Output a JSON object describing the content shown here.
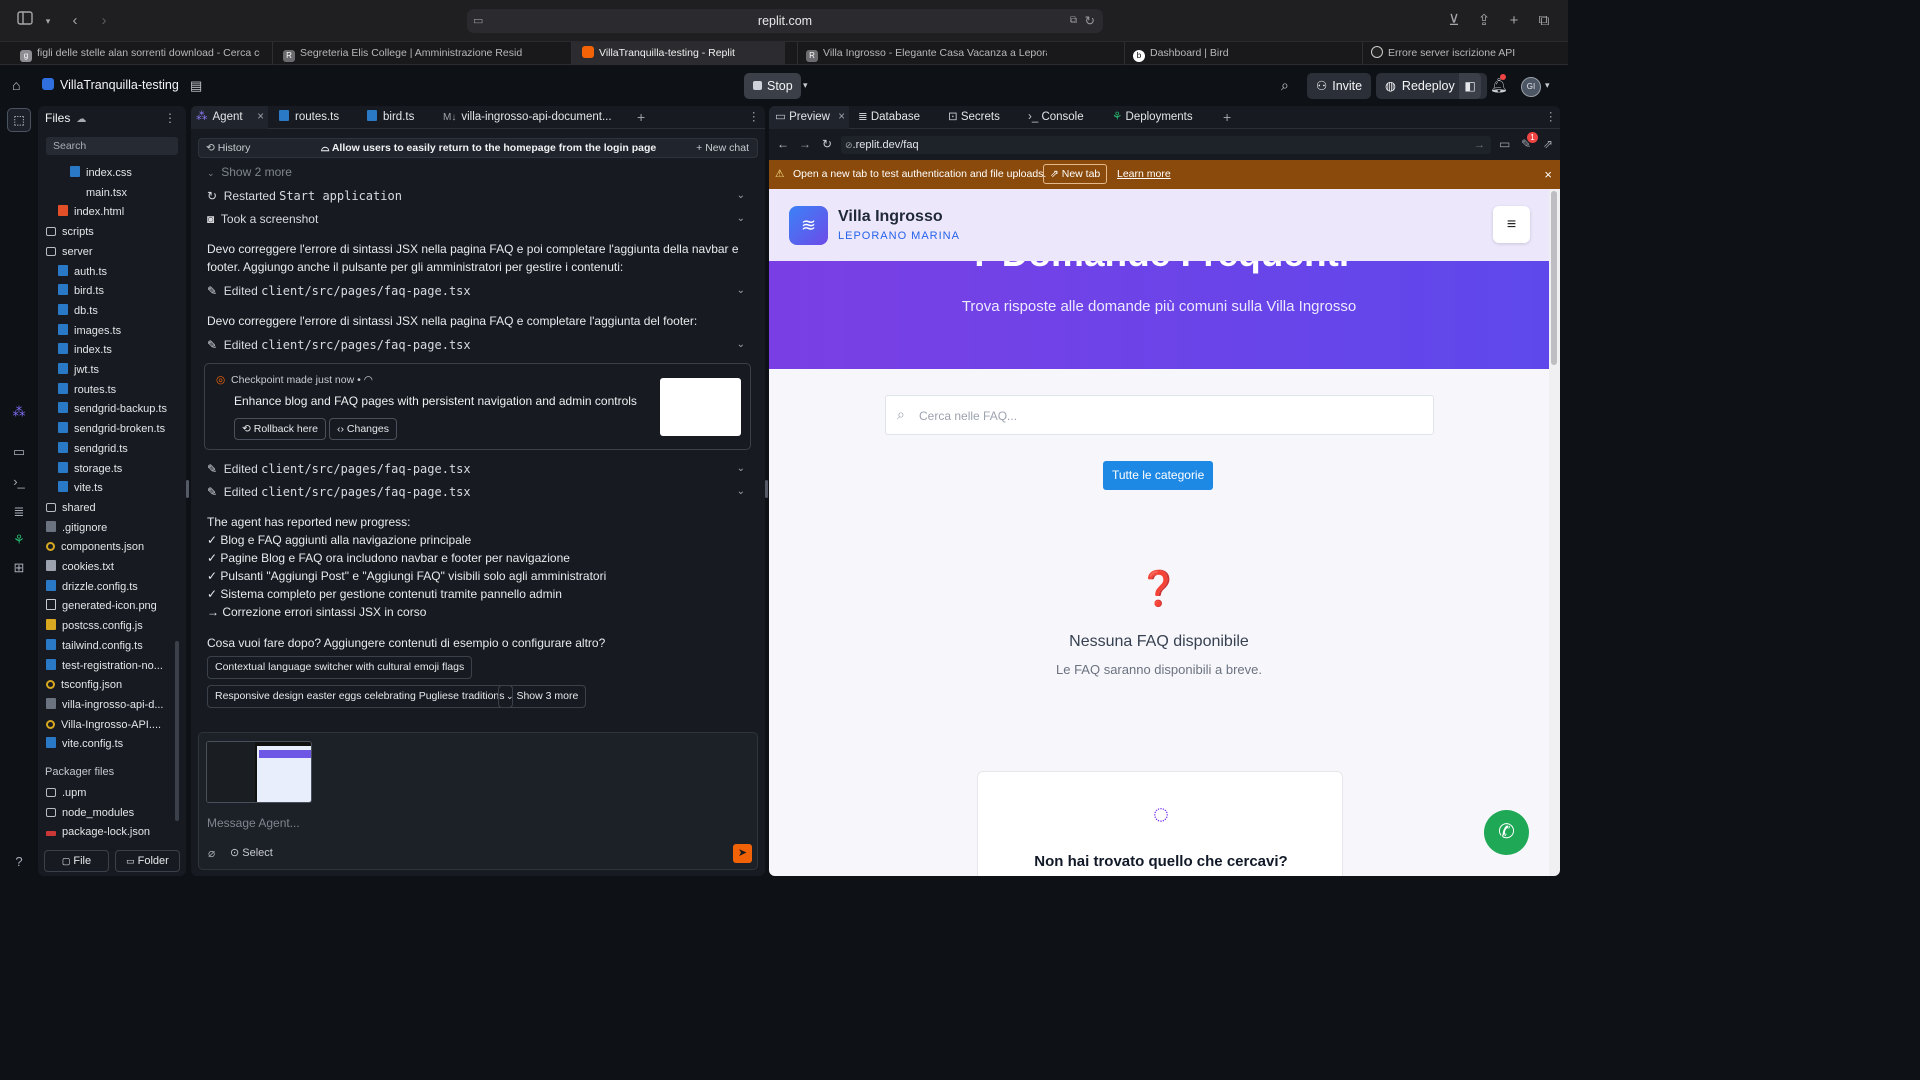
{
  "browser": {
    "url": "replit.com",
    "tabs": [
      {
        "label": "figli delle stelle alan sorrenti download - Cerca con...",
        "icon": "g"
      },
      {
        "label": "Segreteria Elis College | Amministrazione Residenza",
        "icon": "R"
      },
      {
        "label": "VillaTranquilla-testing - Replit",
        "icon": "r",
        "active": true
      },
      {
        "label": "Villa Ingrosso - Elegante Casa Vacanza a Leporano",
        "icon": "R"
      },
      {
        "label": "Dashboard | Bird",
        "icon": "b"
      },
      {
        "label": "Errore server iscrizione API",
        "icon": "o"
      }
    ]
  },
  "topbar": {
    "project_name": "VillaTranquilla-testing",
    "stop_label": "Stop",
    "invite_label": "Invite",
    "redeploy_label": "Redeploy",
    "notification_count": "1"
  },
  "files": {
    "title": "Files",
    "search_placeholder": "Search",
    "items": [
      {
        "name": "index.css",
        "type": "css",
        "indent": 2
      },
      {
        "name": "main.tsx",
        "type": "react",
        "indent": 2
      },
      {
        "name": "index.html",
        "type": "html",
        "indent": 1
      },
      {
        "name": "scripts",
        "type": "folder",
        "indent": 0
      },
      {
        "name": "server",
        "type": "folder",
        "indent": 0
      },
      {
        "name": "auth.ts",
        "type": "ts",
        "indent": 1
      },
      {
        "name": "bird.ts",
        "type": "ts",
        "indent": 1
      },
      {
        "name": "db.ts",
        "type": "ts",
        "indent": 1
      },
      {
        "name": "images.ts",
        "type": "ts",
        "indent": 1
      },
      {
        "name": "index.ts",
        "type": "ts",
        "indent": 1
      },
      {
        "name": "jwt.ts",
        "type": "ts",
        "indent": 1
      },
      {
        "name": "routes.ts",
        "type": "ts",
        "indent": 1
      },
      {
        "name": "sendgrid-backup.ts",
        "type": "ts",
        "indent": 1
      },
      {
        "name": "sendgrid-broken.ts",
        "type": "ts",
        "indent": 1
      },
      {
        "name": "sendgrid.ts",
        "type": "ts",
        "indent": 1
      },
      {
        "name": "storage.ts",
        "type": "ts",
        "indent": 1
      },
      {
        "name": "vite.ts",
        "type": "ts",
        "indent": 1
      },
      {
        "name": "shared",
        "type": "folder",
        "indent": 0
      },
      {
        "name": ".gitignore",
        "type": "config",
        "indent": 0
      },
      {
        "name": "components.json",
        "type": "json",
        "indent": 0
      },
      {
        "name": "cookies.txt",
        "type": "text",
        "indent": 0
      },
      {
        "name": "drizzle.config.ts",
        "type": "ts",
        "indent": 0
      },
      {
        "name": "generated-icon.png",
        "type": "image",
        "indent": 0
      },
      {
        "name": "postcss.config.js",
        "type": "js",
        "indent": 0
      },
      {
        "name": "tailwind.config.ts",
        "type": "ts",
        "indent": 0
      },
      {
        "name": "test-registration-no...",
        "type": "ts",
        "indent": 0
      },
      {
        "name": "tsconfig.json",
        "type": "json",
        "indent": 0
      },
      {
        "name": "villa-ingrosso-api-d...",
        "type": "md",
        "indent": 0
      },
      {
        "name": "Villa-Ingrosso-API....",
        "type": "json",
        "indent": 0
      },
      {
        "name": "vite.config.ts",
        "type": "ts",
        "indent": 0
      }
    ],
    "packager_title": "Packager files",
    "packager_items": [
      {
        "name": ".upm",
        "type": "folder"
      },
      {
        "name": "node_modules",
        "type": "folder"
      },
      {
        "name": "package-lock.json",
        "type": "npm"
      }
    ],
    "new_file_label": "File",
    "new_folder_label": "Folder"
  },
  "agent": {
    "tabs": [
      "Agent",
      "routes.ts",
      "bird.ts",
      "villa-ingrosso-api-document..."
    ],
    "history_label": "History",
    "chat_title": "Allow users to easily return to the homepage from the login page",
    "new_chat_label": "New chat",
    "show_more_top": "Show 2 more",
    "restarted_label": "Restarted",
    "restarted_code": "Start application",
    "screenshot_label": "Took a screenshot",
    "msg1": "Devo correggere l'errore di sintassi JSX nella pagina FAQ e poi completare l'aggiunta della navbar e footer. Aggiungo anche il pulsante per gli amministratori per gestire i contenuti:",
    "edited_label": "Edited",
    "edited_path": "client/src/pages/faq-page.tsx",
    "msg2": "Devo correggere l'errore di sintassi JSX nella pagina FAQ e completare l'aggiunta del footer:",
    "checkpoint_label": "Checkpoint made just now",
    "checkpoint_desc": "Enhance blog and FAQ pages with persistent navigation and admin controls",
    "rollback_label": "Rollback here",
    "changes_label": "Changes",
    "progress_title": "The agent has reported new progress:",
    "progress_items": [
      "✓ Blog e FAQ aggiunti alla navigazione principale",
      "✓ Pagine Blog e FAQ ora includono navbar e footer per navigazione",
      "✓ Pulsanti \"Aggiungi Post\" e \"Aggiungi FAQ\" visibili solo agli amministratori",
      "✓ Sistema completo per gestione contenuti tramite pannello admin",
      "→ Correzione errori sintassi JSX in corso"
    ],
    "question": "Cosa vuoi fare dopo? Aggiungere contenuti di esempio o configurare altro?",
    "suggestions": [
      "Contextual language switcher with cultural emoji flags",
      "Responsive design easter eggs celebrating Pugliese traditions"
    ],
    "show_more_suggestions": "Show 3 more",
    "input_placeholder": "Message Agent...",
    "select_label": "Select"
  },
  "preview": {
    "tabs": [
      "Preview",
      "Database",
      "Secrets",
      "Console",
      "Deployments"
    ],
    "url": ".replit.dev/faq",
    "warning_text": "Open a new tab to test authentication and file uploads.",
    "new_tab_label": "New tab",
    "learn_more_label": "Learn more",
    "notification_count": "1",
    "site": {
      "brand_name": "Villa Ingrosso",
      "brand_sub": "LEPORANO MARINA",
      "hero_title": "Domande Frequenti",
      "hero_subtitle": "Trova risposte alle domande più comuni sulla Villa Ingrosso",
      "search_placeholder": "Cerca nelle FAQ...",
      "category_button": "Tutte le categorie",
      "empty_icon": "❓",
      "empty_title": "Nessuna FAQ disponibile",
      "empty_desc": "Le FAQ saranno disponibili a breve.",
      "help_title": "Non hai trovato quello che cercavi?"
    }
  },
  "colors": {
    "accent_orange": "#f26207",
    "warning_bar": "#8a4a0b",
    "site_blue": "#1e88e5",
    "hero_purple": "#6a3de8",
    "whatsapp_green": "#1fa855"
  }
}
